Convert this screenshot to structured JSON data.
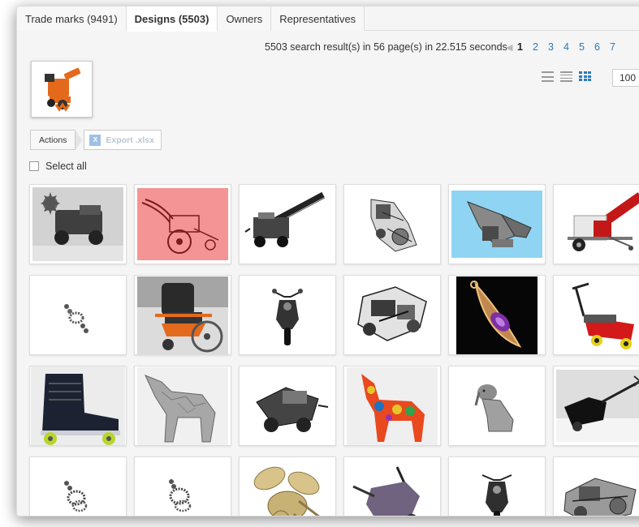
{
  "tabs": [
    {
      "label": "Trade marks (9491)",
      "active": false
    },
    {
      "label": "Designs (5503)",
      "active": true
    },
    {
      "label": "Owners",
      "active": false
    },
    {
      "label": "Representatives",
      "active": false
    }
  ],
  "results": {
    "summary": "5503 search result(s) in 56 page(s) in 22.515 seconds",
    "pages": [
      "1",
      "2",
      "3",
      "4",
      "5",
      "6",
      "7"
    ],
    "current_page": "1"
  },
  "per_page": "100",
  "actions": {
    "label": "Actions",
    "export_label": "Export .xlsx",
    "xlsx_icon_text": "X"
  },
  "select_all_label": "Select all",
  "query_image": {
    "icon": "orange-machine-image"
  },
  "results_grid": [
    {
      "icon": "spiked-roller-machine-photo"
    },
    {
      "icon": "red-cultivator-drawing"
    },
    {
      "icon": "conveyor-machine-drawing"
    },
    {
      "icon": "mechanical-assembly-drawing"
    },
    {
      "icon": "grey-machine-on-blue-render"
    },
    {
      "icon": "red-wood-chipper-trailer"
    },
    {
      "icon": "pendant-earring-drawing"
    },
    {
      "icon": "orange-wheelchair-photo"
    },
    {
      "icon": "motorcycle-front-drawing"
    },
    {
      "icon": "engine-block-drawing"
    },
    {
      "icon": "amethyst-pendant-photo"
    },
    {
      "icon": "red-lawn-mower-photo"
    },
    {
      "icon": "inline-skate-photo"
    },
    {
      "icon": "mosaic-wolf-sculpture"
    },
    {
      "icon": "cart-machine-drawing"
    },
    {
      "icon": "mosaic-dog-sculpture"
    },
    {
      "icon": "sitting-dog-figurine"
    },
    {
      "icon": "black-machine-arm-photo"
    },
    {
      "icon": "chandelier-earring-drawing"
    },
    {
      "icon": "chandelier-earring-drawing"
    },
    {
      "icon": "golden-bee-render"
    },
    {
      "icon": "purple-machine-render"
    },
    {
      "icon": "motorcycle-front-drawing"
    },
    {
      "icon": "mechanical-assembly-drawing"
    }
  ],
  "colors": {
    "link": "#2a7ab8",
    "accent_orange": "#e36a1c",
    "pink_bg": "#f49494",
    "sky_bg": "#8fd4f2",
    "wolf_gray": "#a7a7a7"
  }
}
